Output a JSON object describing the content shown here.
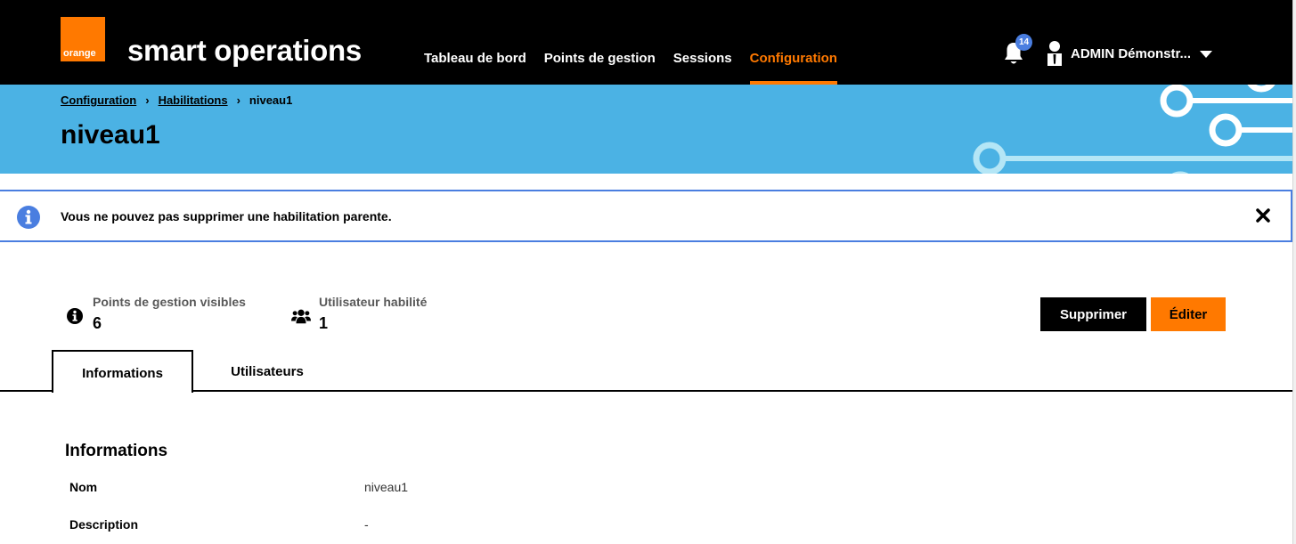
{
  "header": {
    "logo_text": "orange",
    "brand": "smart operations",
    "nav": [
      {
        "label": "Tableau de bord",
        "active": false
      },
      {
        "label": "Points de gestion",
        "active": false
      },
      {
        "label": "Sessions",
        "active": false
      },
      {
        "label": "Configuration",
        "active": true
      }
    ],
    "notifications": {
      "icon": "bell-icon",
      "count": "14"
    },
    "user": {
      "icon": "user-icon",
      "name": "ADMIN Démonstr..."
    }
  },
  "banner": {
    "breadcrumb": [
      {
        "label": "Configuration",
        "link": true
      },
      {
        "label": "Habilitations",
        "link": true
      },
      {
        "label": "niveau1",
        "link": false
      }
    ],
    "title": "niveau1"
  },
  "alert": {
    "icon": "info-circle-icon",
    "message": "Vous ne pouvez pas supprimer une habilitation parente.",
    "close_icon": "close-icon"
  },
  "stats": [
    {
      "icon": "info-circle-icon",
      "label": "Points de gestion visibles",
      "value": "6"
    },
    {
      "icon": "users-icon",
      "label": "Utilisateur habilité",
      "value": "1"
    }
  ],
  "actions": {
    "delete_label": "Supprimer",
    "edit_label": "Éditer"
  },
  "tabs": [
    {
      "label": "Informations",
      "active": true
    },
    {
      "label": "Utilisateurs",
      "active": false
    }
  ],
  "informations": {
    "title": "Informations",
    "rows": [
      {
        "label": "Nom",
        "value": "niveau1"
      },
      {
        "label": "Description",
        "value": "-"
      }
    ]
  },
  "colors": {
    "brand_orange": "#ff7900",
    "banner_blue": "#4bb2e4",
    "info_blue": "#4a7ee0",
    "header_black": "#000000"
  }
}
